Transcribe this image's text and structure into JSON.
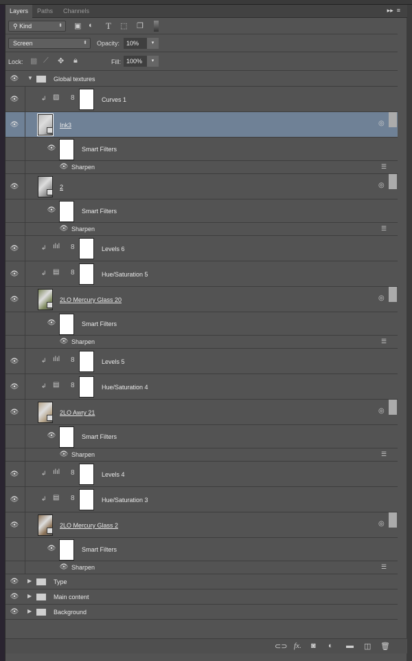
{
  "tabs": [
    {
      "label": "Layers",
      "active": true
    },
    {
      "label": "Paths",
      "active": false
    },
    {
      "label": "Channels",
      "active": false
    }
  ],
  "tab_icons": {
    "collapse": "▸▸",
    "menu": "≡"
  },
  "filter": {
    "kind_label": "Kind",
    "icons": [
      "image-filter-icon",
      "adjustment-filter-icon",
      "type-filter-icon",
      "shape-filter-icon",
      "smart-object-filter-icon",
      "filter-toggle-icon"
    ]
  },
  "blend": {
    "mode": "Screen",
    "opacity_label": "Opacity:",
    "opacity": "10%"
  },
  "lock": {
    "label": "Lock:",
    "fill_label": "Fill:",
    "fill": "100%"
  },
  "colors": {
    "panel": "#535353",
    "selected": "#6f8196"
  },
  "layers": [
    {
      "type": "group",
      "name": "Global textures",
      "expanded": true,
      "indent": 0
    },
    {
      "type": "adj",
      "name": "Curves 1",
      "icon": "curves-icon"
    },
    {
      "type": "smart",
      "name": "Ink3",
      "selected": true,
      "tex": "#bbb"
    },
    {
      "type": "sf",
      "name": "Smart Filters"
    },
    {
      "type": "filter",
      "name": "Sharpen"
    },
    {
      "type": "smart",
      "name": "2",
      "tex": "#9a9a9a"
    },
    {
      "type": "sf",
      "name": "Smart Filters"
    },
    {
      "type": "filter",
      "name": "Sharpen"
    },
    {
      "type": "adj",
      "name": "Levels 6",
      "icon": "levels-icon"
    },
    {
      "type": "adj",
      "name": "Hue/Saturation 5",
      "icon": "hue-saturation-icon"
    },
    {
      "type": "smart",
      "name": "2LO Mercury Glass 20",
      "tex": "#7f8a5e"
    },
    {
      "type": "sf",
      "name": "Smart Filters"
    },
    {
      "type": "filter",
      "name": "Sharpen"
    },
    {
      "type": "adj",
      "name": "Levels 5",
      "icon": "levels-icon"
    },
    {
      "type": "adj",
      "name": "Hue/Saturation 4",
      "icon": "hue-saturation-icon"
    },
    {
      "type": "smart",
      "name": "2LO Awry 21",
      "tex": "#b7a58a"
    },
    {
      "type": "sf",
      "name": "Smart Filters"
    },
    {
      "type": "filter",
      "name": "Sharpen"
    },
    {
      "type": "adj",
      "name": "Levels 4",
      "icon": "levels-icon"
    },
    {
      "type": "adj",
      "name": "Hue/Saturation 3",
      "icon": "hue-saturation-icon"
    },
    {
      "type": "smart",
      "name": "2LO Mercury Glass 2",
      "tex": "#8d7458"
    },
    {
      "type": "sf",
      "name": "Smart Filters"
    },
    {
      "type": "filter",
      "name": "Sharpen"
    },
    {
      "type": "group",
      "name": "Type",
      "expanded": false
    },
    {
      "type": "group",
      "name": "Main content",
      "expanded": false
    },
    {
      "type": "group",
      "name": "Background",
      "expanded": false
    }
  ],
  "footer_icons": [
    "link-layers-icon",
    "fx-icon",
    "add-mask-icon",
    "new-adjustment-icon",
    "new-group-icon",
    "new-layer-icon",
    "delete-icon"
  ]
}
